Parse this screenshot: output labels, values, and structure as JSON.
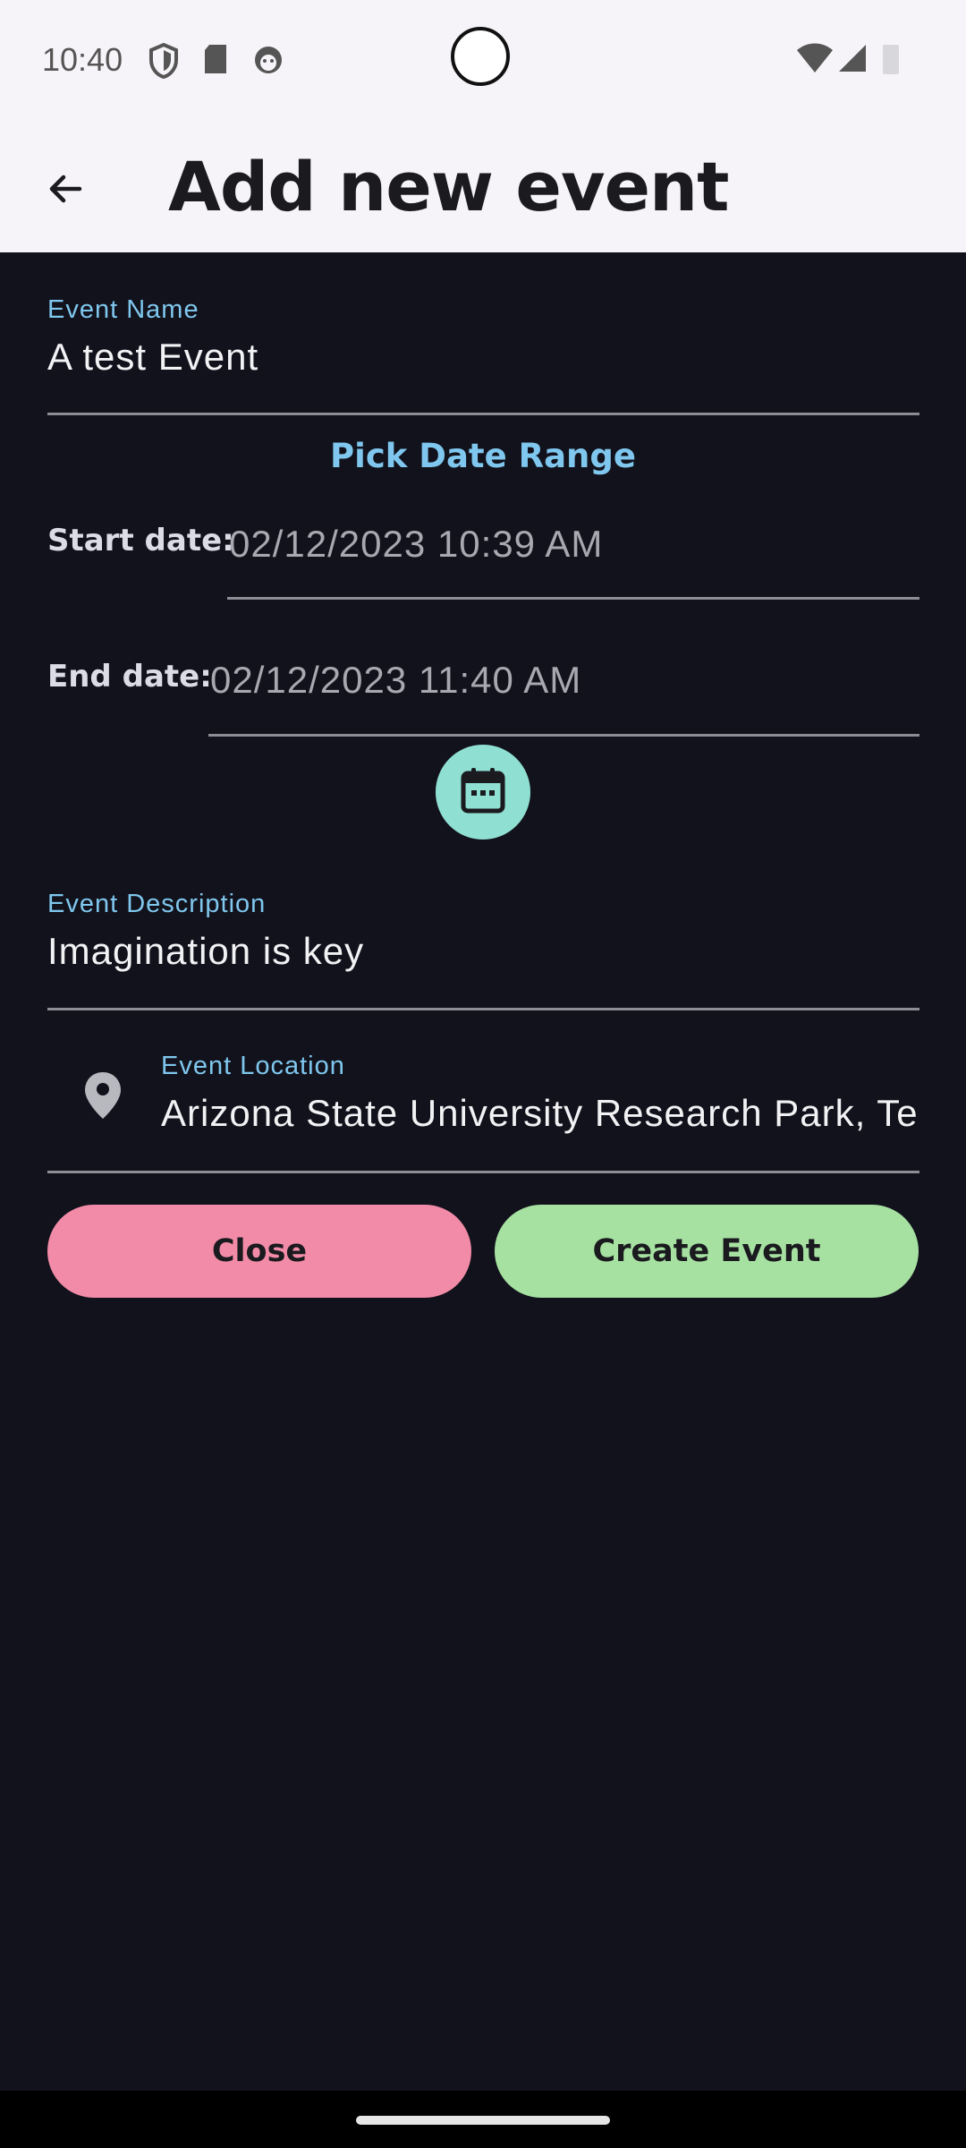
{
  "status_bar": {
    "time": "10:40",
    "icons": [
      "shield-icon",
      "sd-card-icon",
      "cat-face-icon",
      "wifi-icon",
      "signal-icon",
      "battery-icon"
    ]
  },
  "app_bar": {
    "title": "Add new event",
    "back_icon": "arrow-left-icon"
  },
  "form": {
    "event_name": {
      "label": "Event Name",
      "value": "A test Event"
    },
    "pick_date_range": "Pick Date Range",
    "start_date": {
      "label": "Start date:",
      "value": "02/12/2023 10:39 AM"
    },
    "end_date": {
      "label": "End date:",
      "value": "02/12/2023 11:40 AM"
    },
    "calendar_icon": "calendar-icon",
    "event_description": {
      "label": "Event Description",
      "value": "Imagination is key"
    },
    "event_location": {
      "label": "Event Location",
      "value": "Arizona State University Research Park, Tem",
      "icon": "location-pin-icon"
    }
  },
  "actions": {
    "close_label": "Close",
    "create_label": "Create Event"
  },
  "colors": {
    "background": "#12121c",
    "accent": "#7fc7ee",
    "close_button": "#f28ba7",
    "create_button": "#a6e1a1",
    "calendar_button": "#8fe0d2"
  }
}
